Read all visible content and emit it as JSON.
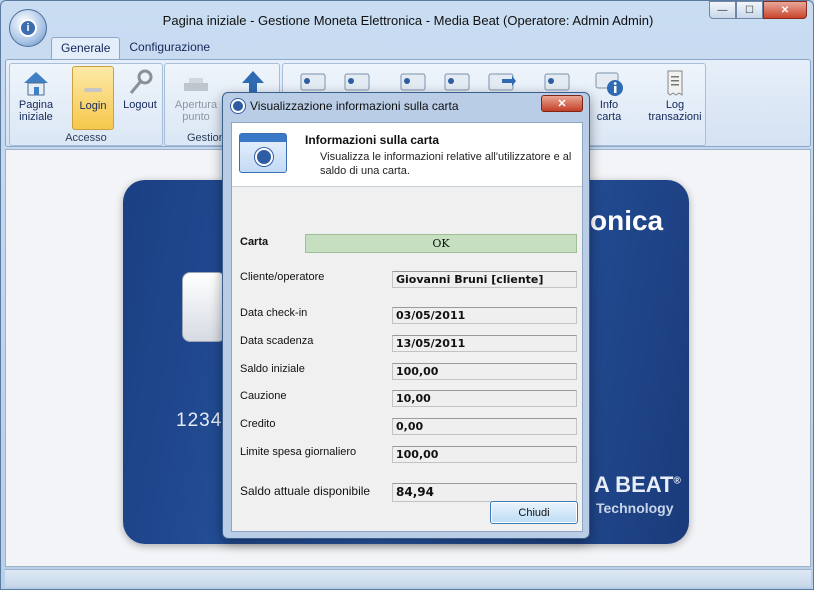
{
  "window": {
    "title": "Pagina iniziale - Gestione Moneta Elettronica - Media Beat (Operatore: Admin Admin)",
    "minimize": "—",
    "maximize": "☐",
    "close": "✕"
  },
  "tabs": [
    {
      "label": "Generale",
      "active": true
    },
    {
      "label": "Configurazione",
      "active": false
    }
  ],
  "ribbon": {
    "home": "Pagina iniziale",
    "login": "Login",
    "logout": "Logout",
    "accesso_group": "Accesso",
    "apertura": "Apertura punto",
    "gestione_group": "Gestione",
    "info_carta": "Info carta",
    "log_transazioni": "Log transazioni"
  },
  "card": {
    "brand_suffix": "onica",
    "number_prefix": "1234",
    "beat": "A BEAT",
    "reg": "®",
    "technology": "Technology"
  },
  "dialog": {
    "title": "Visualizzazione informazioni sulla carta",
    "close": "✕",
    "header_title": "Informazioni sulla carta",
    "header_desc": "Visualizza le informazioni relative all'utilizzatore e al saldo di una carta.",
    "carta_label": "Carta",
    "carta_status": "OK",
    "fields": [
      {
        "label": "Cliente/operatore",
        "value": "Giovanni Bruni [cliente]"
      },
      {
        "label": "Data check-in",
        "value": "03/05/2011"
      },
      {
        "label": "Data scadenza",
        "value": "13/05/2011"
      },
      {
        "label": "Saldo iniziale",
        "value": "100,00"
      },
      {
        "label": "Cauzione",
        "value": "10,00"
      },
      {
        "label": "Credito",
        "value": "0,00"
      },
      {
        "label": "Limite spesa giornaliero",
        "value": "100,00"
      },
      {
        "label": "Saldo attuale disponibile",
        "value": "84,94"
      }
    ],
    "chiudi": "Chiudi"
  }
}
